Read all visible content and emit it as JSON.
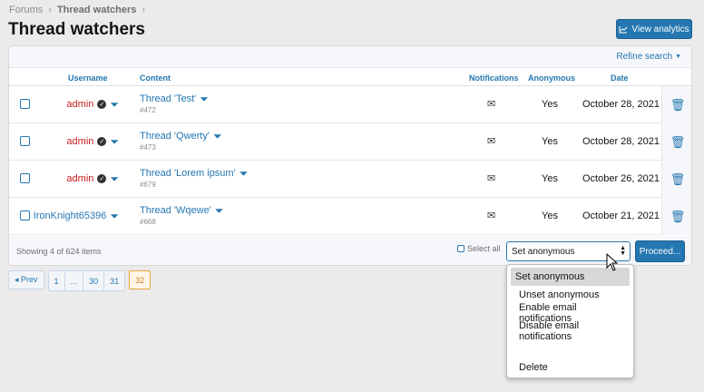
{
  "breadcrumb": {
    "items": [
      "Forums",
      "Thread watchers"
    ],
    "separator": "›"
  },
  "page": {
    "title": "Thread watchers"
  },
  "header": {
    "view_analytics_label": "View analytics"
  },
  "refine": {
    "label": "Refine search"
  },
  "table": {
    "columns": {
      "username": "Username",
      "content": "Content",
      "notifications": "Notifications",
      "anonymous": "Anonymous",
      "date": "Date"
    },
    "rows": [
      {
        "username": "admin",
        "role": "admin",
        "content": "Thread 'Test'",
        "id": "#472",
        "anonymous": "Yes",
        "date": "October 28, 2021"
      },
      {
        "username": "admin",
        "role": "admin",
        "content": "Thread 'Qwerty'",
        "id": "#473",
        "anonymous": "Yes",
        "date": "October 28, 2021"
      },
      {
        "username": "admin",
        "role": "admin",
        "content": "Thread 'Lorem ipsum'",
        "id": "#679",
        "anonymous": "Yes",
        "date": "October 26, 2021"
      },
      {
        "username": "IronKnight65396",
        "role": "user",
        "content": "Thread 'Wqewe'",
        "id": "#668",
        "anonymous": "Yes",
        "date": "October 21, 2021"
      }
    ]
  },
  "footer": {
    "count": "Showing 4 of 624 items",
    "select_all": "Select all"
  },
  "action": {
    "selected": "Set anonymous",
    "proceed_label": "Proceed..."
  },
  "dropdown": {
    "options": [
      "Set anonymous",
      "Unset anonymous",
      "Enable email notifications",
      "Disable email notifications",
      "",
      "Delete"
    ]
  },
  "pagination": {
    "prev": "◂ Prev",
    "pages": [
      "1",
      "...",
      "30",
      "31"
    ],
    "current": "32"
  },
  "colors": {
    "accent": "#2577b1",
    "admin": "#c41d1d",
    "current_page": "#d4832a"
  }
}
